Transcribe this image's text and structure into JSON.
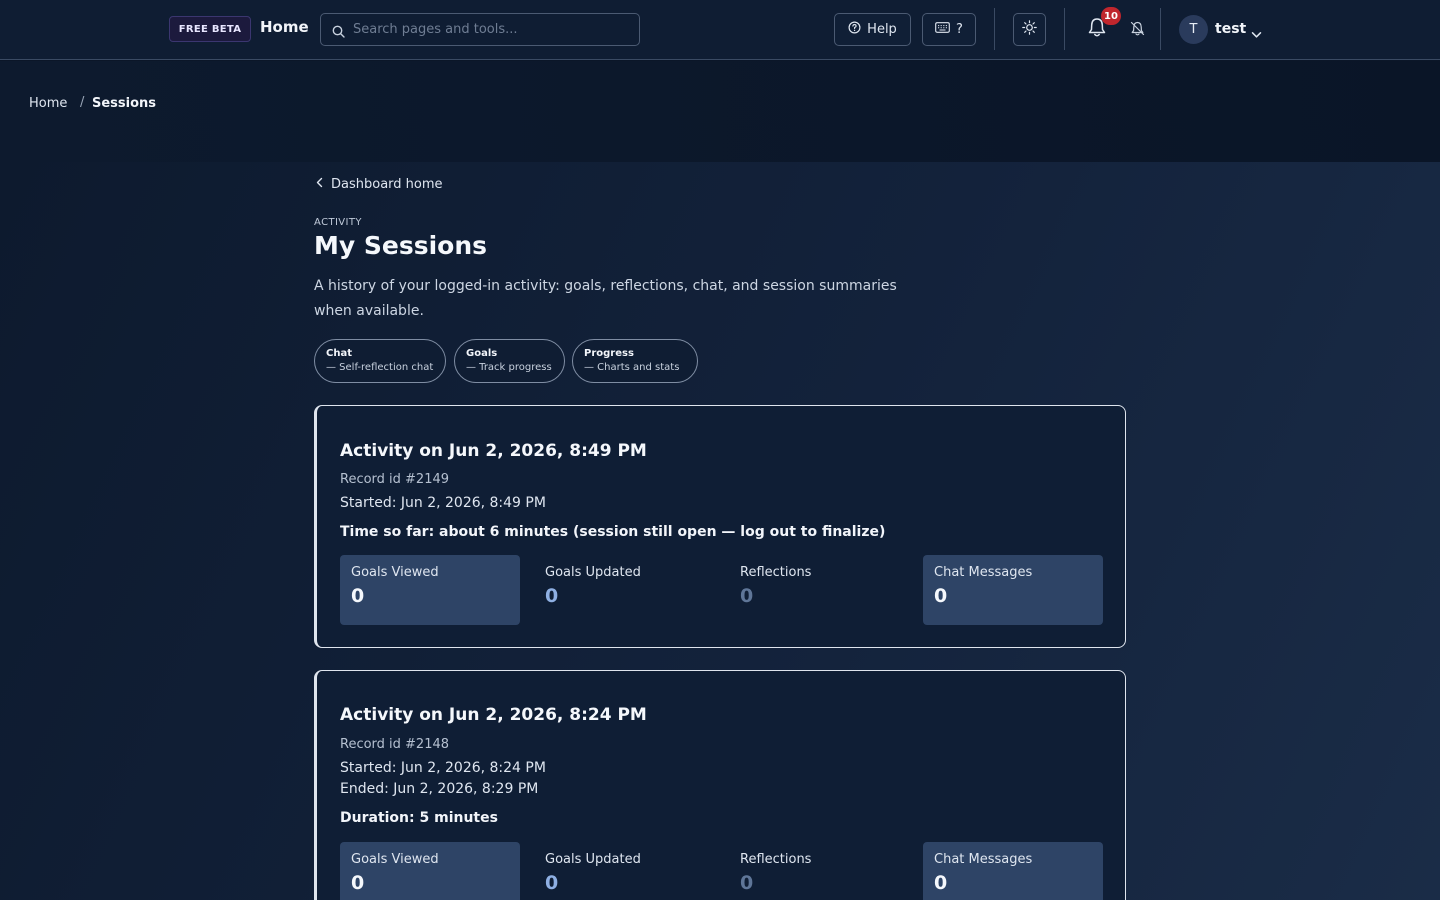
{
  "header": {
    "beta_badge": "FREE BETA",
    "home_label": "Home",
    "search_placeholder": "Search pages and tools...",
    "help_label": "Help",
    "shortcuts_label": "?",
    "notifications_count": "10",
    "user": {
      "initial": "T",
      "name": "test"
    }
  },
  "breadcrumb": {
    "home": "Home",
    "separator": "/",
    "current": "Sessions"
  },
  "page": {
    "back_link": "Dashboard home",
    "eyebrow": "ACTIVITY",
    "title": "My Sessions",
    "description": "A history of your logged-in activity: goals, reflections, chat, and session summaries when available."
  },
  "quick_links": [
    {
      "title": "Chat",
      "subtitle": "— Self-reflection chat"
    },
    {
      "title": "Goals",
      "subtitle": "— Track progress"
    },
    {
      "title": "Progress",
      "subtitle": "— Charts and stats"
    }
  ],
  "sessions": [
    {
      "title": "Activity on Jun 2, 2026, 8:49 PM",
      "record_id": "Record id #2149",
      "started": "Started: Jun 2, 2026, 8:49 PM",
      "duration": "Time so far: about 6 minutes (session still open — log out to finalize)",
      "stats": [
        {
          "label": "Goals Viewed",
          "value": "0"
        },
        {
          "label": "Goals Updated",
          "value": "0"
        },
        {
          "label": "Reflections",
          "value": "0"
        },
        {
          "label": "Chat Messages",
          "value": "0"
        }
      ]
    },
    {
      "title": "Activity on Jun 2, 2026, 8:24 PM",
      "record_id": "Record id #2148",
      "started": "Started: Jun 2, 2026, 8:24 PM",
      "ended": "Ended: Jun 2, 2026, 8:29 PM",
      "duration": "Duration: 5 minutes",
      "stats": [
        {
          "label": "Goals Viewed",
          "value": "0"
        },
        {
          "label": "Goals Updated",
          "value": "0"
        },
        {
          "label": "Reflections",
          "value": "0"
        },
        {
          "label": "Chat Messages",
          "value": "0"
        }
      ]
    }
  ],
  "icons": {
    "search": "search-icon",
    "help": "question-circle-icon",
    "keyboard": "keyboard-icon",
    "theme": "sun-icon",
    "notifications": "bell-icon",
    "mute": "bell-off-icon",
    "back": "chevron-left-icon",
    "user_menu": "chevron-down-icon"
  },
  "colors": {
    "background": "#0b1628",
    "header": "#0f1d33",
    "stat_highlight": "#2e4466",
    "notification_badge": "#c0262d"
  }
}
